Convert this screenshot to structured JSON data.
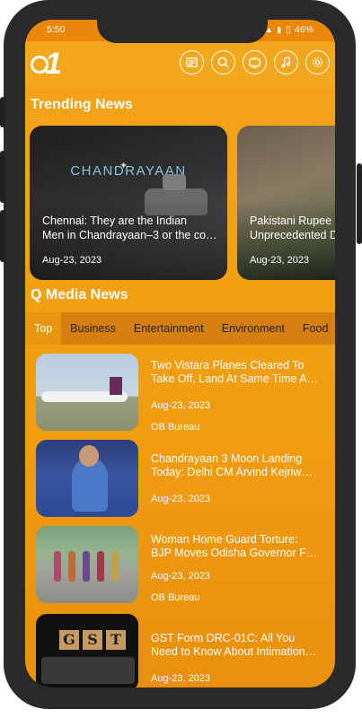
{
  "status_bar": {
    "time": "5:50",
    "battery": "46%"
  },
  "app_bar": {
    "logo_text": "1",
    "icons": [
      "newspaper-icon",
      "search-icon",
      "tv-icon",
      "music-icon",
      "settings-icon"
    ]
  },
  "trending": {
    "heading": "Trending News",
    "cards": [
      {
        "title_line1": "Chennai: They are the Indian",
        "title_line2": "Men in Chandrayaan–3 or the co…",
        "date": "Aug-23, 2023",
        "image_text": "CHANDRAYAAN"
      },
      {
        "title_line1": "Pakistani Rupee I",
        "title_line2": "Unprecedented D",
        "date": "Aug-23, 2023"
      }
    ]
  },
  "qmedia": {
    "heading": "Q Media News",
    "tabs": [
      "Top",
      "Business",
      "Entertainment",
      "Environment",
      "Food"
    ],
    "active_tab": "Top",
    "items": [
      {
        "title_line1": "Two Vistara Planes Cleared To",
        "title_line2": "Take Off, Land At Same Time A…",
        "date": "Aug-23, 2023",
        "author": "OB Bureau"
      },
      {
        "title_line1": "Chandrayaan 3 Moon Landing",
        "title_line2": "Today: Delhi CM Arvind Kejriwal…",
        "date": "Aug-23, 2023",
        "author": ""
      },
      {
        "title_line1": "Woman Home Guard Torture:",
        "title_line2": "BJP Moves Odisha Governor F…",
        "date": "Aug-23, 2023",
        "author": "OB Bureau"
      },
      {
        "title_line1": "GST Form DRC-01C: All You",
        "title_line2": "Need to Know About Intimation…",
        "date": "Aug-23, 2023",
        "author": ""
      }
    ]
  },
  "colors": {
    "primary": "#f2a013",
    "tab_bar": "#d57f10",
    "frame": "#2a2a2a"
  }
}
